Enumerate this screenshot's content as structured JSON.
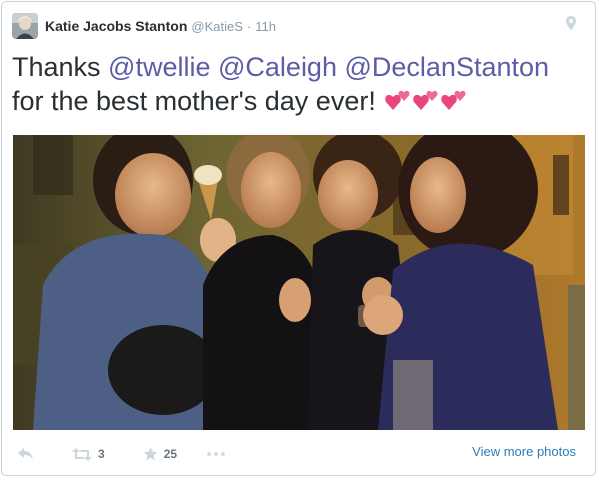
{
  "tweet": {
    "author_name": "Katie Jacobs Stanton",
    "author_handle": "@KatieS",
    "separator": "·",
    "time": "11h",
    "text_prefix": "Thanks ",
    "mentions": [
      "@twellie",
      "@Caleigh",
      "@DeclanStanton"
    ],
    "text_line2": "for the best mother's day ever!",
    "emoji": [
      "two-hearts-emoji",
      "two-hearts-emoji",
      "two-hearts-emoji"
    ]
  },
  "actions": {
    "reply_icon": "reply-icon",
    "retweet_icon": "retweet-icon",
    "retweet_count": "3",
    "favorite_icon": "star-icon",
    "favorite_count": "25",
    "more_icon": "more-dots-icon",
    "view_more_photos": "View more photos"
  },
  "colors": {
    "mention": "#5b5ea6",
    "link": "#2b7bb9",
    "muted": "#8899a6",
    "heart": "#e8467c"
  }
}
